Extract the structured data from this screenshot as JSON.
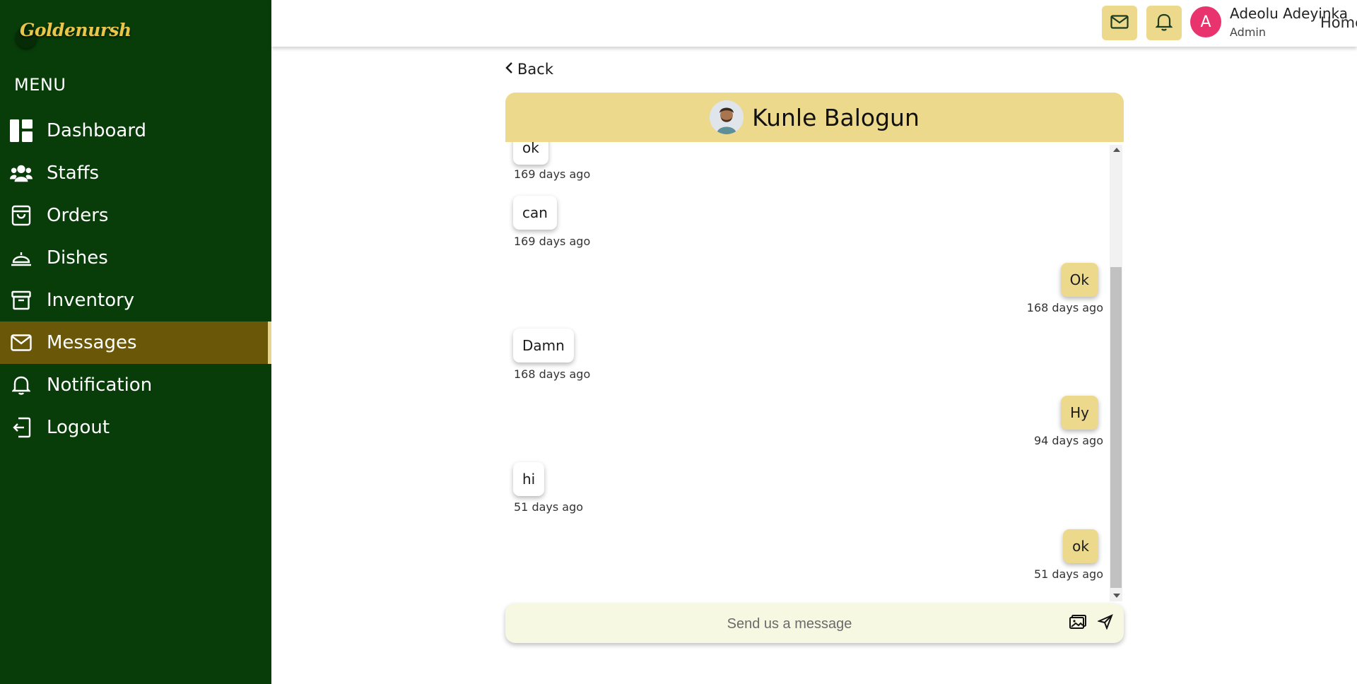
{
  "brand": {
    "logo_text": "Goldenursh",
    "menu_title": "MENU"
  },
  "sidebar": {
    "items": [
      {
        "label": "Dashboard",
        "icon": "dashboard-icon"
      },
      {
        "label": "Staffs",
        "icon": "users-icon"
      },
      {
        "label": "Orders",
        "icon": "shopping-bag-icon"
      },
      {
        "label": "Dishes",
        "icon": "cloche-icon"
      },
      {
        "label": "Inventory",
        "icon": "archive-icon"
      },
      {
        "label": "Messages",
        "icon": "mail-icon",
        "active": true
      },
      {
        "label": "Notification",
        "icon": "bell-icon"
      },
      {
        "label": "Logout",
        "icon": "logout-icon"
      }
    ]
  },
  "header": {
    "home_label": "Home",
    "user": {
      "initial": "A",
      "name": "Adeolu Adeyinka",
      "role": "Admin"
    }
  },
  "chat": {
    "back_label": "Back",
    "contact_name": "Kunle Balogun",
    "messages": [
      {
        "text": "ok",
        "time": "169 days ago",
        "from": "contact"
      },
      {
        "text": "can",
        "time": "169 days ago",
        "from": "contact"
      },
      {
        "text": "Ok",
        "time": "168 days ago",
        "from": "me"
      },
      {
        "text": "Damn",
        "time": "168 days ago",
        "from": "contact"
      },
      {
        "text": "Hy",
        "time": "94 days ago",
        "from": "me"
      },
      {
        "text": "hi",
        "time": "51 days ago",
        "from": "contact"
      },
      {
        "text": "ok",
        "time": "51 days ago",
        "from": "me"
      }
    ],
    "input_placeholder": "Send us a message"
  },
  "colors": {
    "sidebar_bg": "#083d0a",
    "active_item_bg": "#6b5708",
    "accent_gold": "#ecd98c",
    "avatar_pink": "#e8336f",
    "composer_bg": "#f6f8e2"
  }
}
